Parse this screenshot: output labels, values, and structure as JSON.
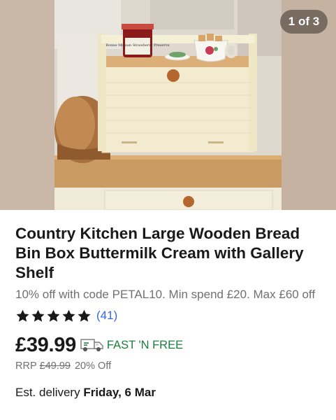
{
  "gallery": {
    "counter": "1 of 3",
    "jar_label": "Bonne Maman Strawberry Preserve"
  },
  "product": {
    "title": "Country Kitchen Large Wooden Bread Bin Box Buttermilk Cream with Gallery Shelf",
    "promo": "10% off with code PETAL10. Min spend £20. Max £60 off",
    "rating_stars": 5,
    "review_count": "(41)",
    "price": "£39.99",
    "shipping": "FAST 'N FREE",
    "rrp_label": "RRP",
    "rrp_value": "£49.99",
    "discount": "20% Off",
    "delivery_label": "Est. delivery",
    "delivery_date": "Friday, 6 Mar"
  },
  "colors": {
    "link": "#3665f3",
    "shipping_green": "#1a7f3b",
    "muted_text": "#707070",
    "primary_text": "#191919"
  },
  "icons": [
    "star-icon",
    "delivery-truck-icon"
  ]
}
